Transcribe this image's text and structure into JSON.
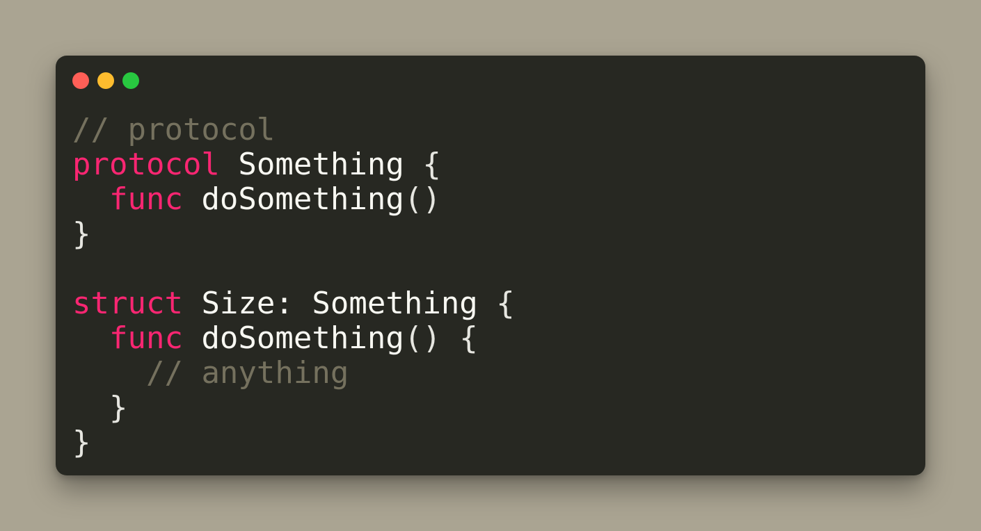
{
  "window": {
    "controls": [
      {
        "name": "close",
        "color": "#ff5f57"
      },
      {
        "name": "minimize",
        "color": "#febc2e"
      },
      {
        "name": "maximize",
        "color": "#28c840"
      }
    ]
  },
  "theme": {
    "background": "#aaa492",
    "editor_bg": "#272822",
    "keyword_color": "#f92672",
    "comment_color": "#75715e",
    "text_color": "#f8f8f2"
  },
  "code": {
    "language": "swift",
    "lines": [
      [
        {
          "t": "// protocol",
          "k": "cm"
        }
      ],
      [
        {
          "t": "protocol",
          "k": "kw"
        },
        {
          "t": " Something ",
          "k": "tx"
        },
        {
          "t": "{",
          "k": "pn"
        }
      ],
      [
        {
          "t": "  ",
          "k": "tx"
        },
        {
          "t": "func",
          "k": "kw"
        },
        {
          "t": " doSomething",
          "k": "tx"
        },
        {
          "t": "()",
          "k": "pn"
        }
      ],
      [
        {
          "t": "}",
          "k": "pn"
        }
      ],
      [
        {
          "t": "",
          "k": "tx"
        }
      ],
      [
        {
          "t": "struct",
          "k": "kw"
        },
        {
          "t": " Size: Something ",
          "k": "tx"
        },
        {
          "t": "{",
          "k": "pn"
        }
      ],
      [
        {
          "t": "  ",
          "k": "tx"
        },
        {
          "t": "func",
          "k": "kw"
        },
        {
          "t": " doSomething",
          "k": "tx"
        },
        {
          "t": "() {",
          "k": "pn"
        }
      ],
      [
        {
          "t": "    ",
          "k": "tx"
        },
        {
          "t": "// anything",
          "k": "cm"
        }
      ],
      [
        {
          "t": "  }",
          "k": "pn"
        }
      ],
      [
        {
          "t": "}",
          "k": "pn"
        }
      ]
    ]
  }
}
